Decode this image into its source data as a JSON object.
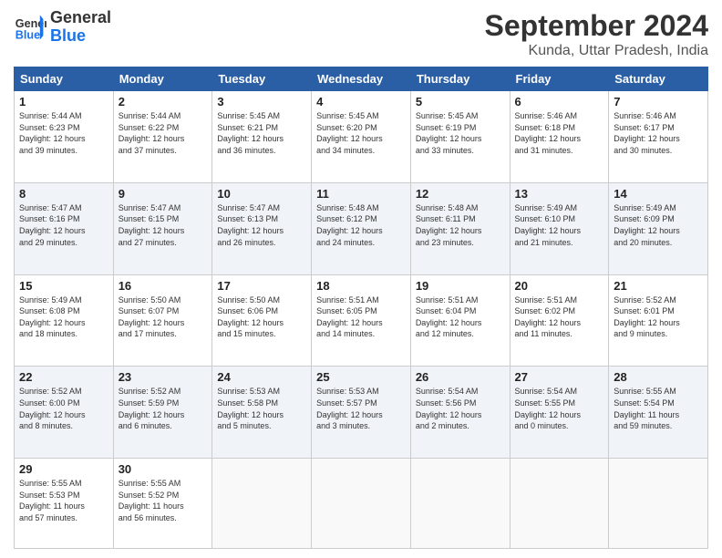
{
  "header": {
    "logo_line1": "General",
    "logo_line2": "Blue",
    "month": "September 2024",
    "location": "Kunda, Uttar Pradesh, India"
  },
  "weekdays": [
    "Sunday",
    "Monday",
    "Tuesday",
    "Wednesday",
    "Thursday",
    "Friday",
    "Saturday"
  ],
  "weeks": [
    [
      {
        "day": "1",
        "info": "Sunrise: 5:44 AM\nSunset: 6:23 PM\nDaylight: 12 hours\nand 39 minutes."
      },
      {
        "day": "2",
        "info": "Sunrise: 5:44 AM\nSunset: 6:22 PM\nDaylight: 12 hours\nand 37 minutes."
      },
      {
        "day": "3",
        "info": "Sunrise: 5:45 AM\nSunset: 6:21 PM\nDaylight: 12 hours\nand 36 minutes."
      },
      {
        "day": "4",
        "info": "Sunrise: 5:45 AM\nSunset: 6:20 PM\nDaylight: 12 hours\nand 34 minutes."
      },
      {
        "day": "5",
        "info": "Sunrise: 5:45 AM\nSunset: 6:19 PM\nDaylight: 12 hours\nand 33 minutes."
      },
      {
        "day": "6",
        "info": "Sunrise: 5:46 AM\nSunset: 6:18 PM\nDaylight: 12 hours\nand 31 minutes."
      },
      {
        "day": "7",
        "info": "Sunrise: 5:46 AM\nSunset: 6:17 PM\nDaylight: 12 hours\nand 30 minutes."
      }
    ],
    [
      {
        "day": "8",
        "info": "Sunrise: 5:47 AM\nSunset: 6:16 PM\nDaylight: 12 hours\nand 29 minutes."
      },
      {
        "day": "9",
        "info": "Sunrise: 5:47 AM\nSunset: 6:15 PM\nDaylight: 12 hours\nand 27 minutes."
      },
      {
        "day": "10",
        "info": "Sunrise: 5:47 AM\nSunset: 6:13 PM\nDaylight: 12 hours\nand 26 minutes."
      },
      {
        "day": "11",
        "info": "Sunrise: 5:48 AM\nSunset: 6:12 PM\nDaylight: 12 hours\nand 24 minutes."
      },
      {
        "day": "12",
        "info": "Sunrise: 5:48 AM\nSunset: 6:11 PM\nDaylight: 12 hours\nand 23 minutes."
      },
      {
        "day": "13",
        "info": "Sunrise: 5:49 AM\nSunset: 6:10 PM\nDaylight: 12 hours\nand 21 minutes."
      },
      {
        "day": "14",
        "info": "Sunrise: 5:49 AM\nSunset: 6:09 PM\nDaylight: 12 hours\nand 20 minutes."
      }
    ],
    [
      {
        "day": "15",
        "info": "Sunrise: 5:49 AM\nSunset: 6:08 PM\nDaylight: 12 hours\nand 18 minutes."
      },
      {
        "day": "16",
        "info": "Sunrise: 5:50 AM\nSunset: 6:07 PM\nDaylight: 12 hours\nand 17 minutes."
      },
      {
        "day": "17",
        "info": "Sunrise: 5:50 AM\nSunset: 6:06 PM\nDaylight: 12 hours\nand 15 minutes."
      },
      {
        "day": "18",
        "info": "Sunrise: 5:51 AM\nSunset: 6:05 PM\nDaylight: 12 hours\nand 14 minutes."
      },
      {
        "day": "19",
        "info": "Sunrise: 5:51 AM\nSunset: 6:04 PM\nDaylight: 12 hours\nand 12 minutes."
      },
      {
        "day": "20",
        "info": "Sunrise: 5:51 AM\nSunset: 6:02 PM\nDaylight: 12 hours\nand 11 minutes."
      },
      {
        "day": "21",
        "info": "Sunrise: 5:52 AM\nSunset: 6:01 PM\nDaylight: 12 hours\nand 9 minutes."
      }
    ],
    [
      {
        "day": "22",
        "info": "Sunrise: 5:52 AM\nSunset: 6:00 PM\nDaylight: 12 hours\nand 8 minutes."
      },
      {
        "day": "23",
        "info": "Sunrise: 5:52 AM\nSunset: 5:59 PM\nDaylight: 12 hours\nand 6 minutes."
      },
      {
        "day": "24",
        "info": "Sunrise: 5:53 AM\nSunset: 5:58 PM\nDaylight: 12 hours\nand 5 minutes."
      },
      {
        "day": "25",
        "info": "Sunrise: 5:53 AM\nSunset: 5:57 PM\nDaylight: 12 hours\nand 3 minutes."
      },
      {
        "day": "26",
        "info": "Sunrise: 5:54 AM\nSunset: 5:56 PM\nDaylight: 12 hours\nand 2 minutes."
      },
      {
        "day": "27",
        "info": "Sunrise: 5:54 AM\nSunset: 5:55 PM\nDaylight: 12 hours\nand 0 minutes."
      },
      {
        "day": "28",
        "info": "Sunrise: 5:55 AM\nSunset: 5:54 PM\nDaylight: 11 hours\nand 59 minutes."
      }
    ],
    [
      {
        "day": "29",
        "info": "Sunrise: 5:55 AM\nSunset: 5:53 PM\nDaylight: 11 hours\nand 57 minutes."
      },
      {
        "day": "30",
        "info": "Sunrise: 5:55 AM\nSunset: 5:52 PM\nDaylight: 11 hours\nand 56 minutes."
      },
      {
        "day": "",
        "info": ""
      },
      {
        "day": "",
        "info": ""
      },
      {
        "day": "",
        "info": ""
      },
      {
        "day": "",
        "info": ""
      },
      {
        "day": "",
        "info": ""
      }
    ]
  ]
}
